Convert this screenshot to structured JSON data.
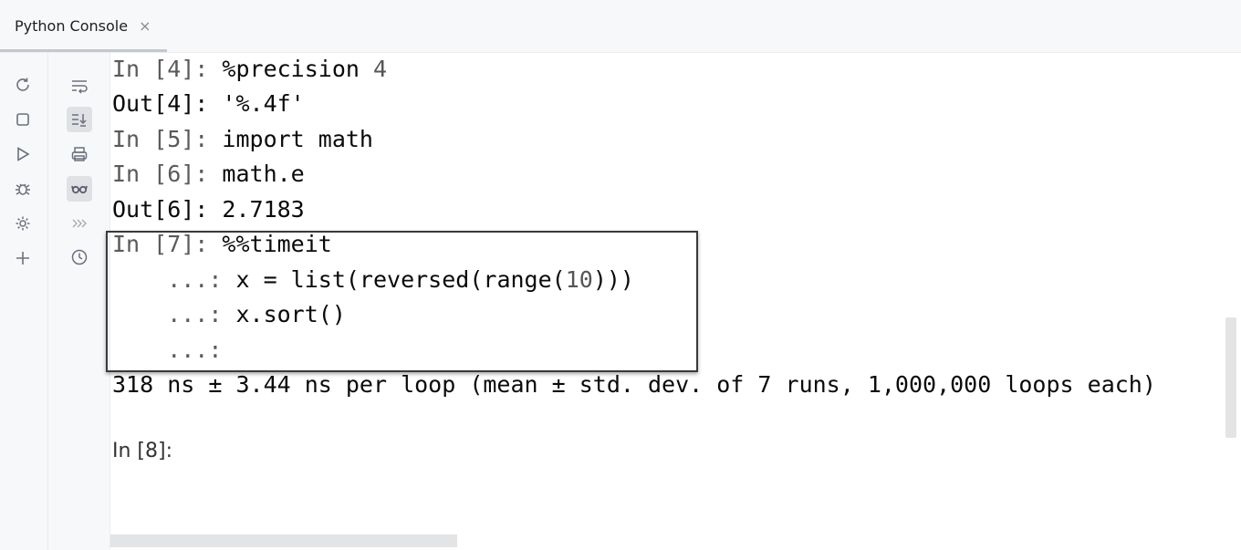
{
  "tab": {
    "title": "Python Console",
    "close_glyph": "×"
  },
  "toolbar_left": [
    {
      "icon": "rerun-icon"
    },
    {
      "icon": "stop-icon"
    },
    {
      "icon": "run-icon"
    },
    {
      "icon": "debug-icon"
    },
    {
      "icon": "settings-icon"
    },
    {
      "icon": "add-icon"
    }
  ],
  "toolbar_right": [
    {
      "icon": "soft-wrap-icon"
    },
    {
      "icon": "scroll-to-end-icon",
      "active": true
    },
    {
      "icon": "print-icon"
    },
    {
      "icon": "show-variables-icon",
      "active": true
    },
    {
      "icon": "more-icon"
    },
    {
      "icon": "history-icon"
    }
  ],
  "console": {
    "lines": [
      {
        "prompt": "In [4]: ",
        "code": "%precision ",
        "extra": "4"
      },
      {
        "prompt": "Out[4]: ",
        "code": "'%.4f'"
      },
      {
        "prompt": "In [5]: ",
        "code": "import math"
      },
      {
        "prompt": "In [6]: ",
        "code": "math.e"
      },
      {
        "prompt": "Out[6]: ",
        "code": "2.7183"
      },
      {
        "prompt": "In [7]: ",
        "code": "%%timeit"
      },
      {
        "prompt": "    ...: ",
        "code": "x = list(reversed(range(",
        "extra": "10",
        "tail": ")))"
      },
      {
        "prompt": "    ...: ",
        "code": "x.sort()"
      },
      {
        "prompt": "    ...: ",
        "code": ""
      }
    ],
    "result": "318 ns ± 3.44 ns per loop (mean ± std. dev. of 7 runs, 1,000,000 loops each)",
    "input_prompt": "In [8]:"
  }
}
